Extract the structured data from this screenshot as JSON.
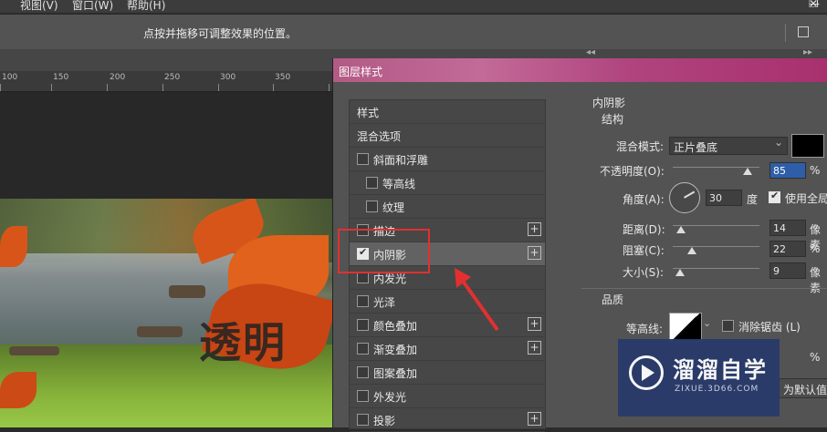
{
  "menu": {
    "view": "视图(V)",
    "window": "窗口(W)",
    "help": "帮助(H)"
  },
  "options_bar": {
    "hint": "点按并拖移可调整效果的位置。"
  },
  "ruler": {
    "ticks": [
      "100",
      "150",
      "200",
      "250",
      "300",
      "350"
    ]
  },
  "canvas": {
    "watermark_text": "透明"
  },
  "dialog": {
    "title": "图层样式",
    "styles_header": "样式",
    "blend_options": "混合选项",
    "items": [
      {
        "label": "斜面和浮雕",
        "checked": false,
        "plus": false,
        "indent": false
      },
      {
        "label": "等高线",
        "checked": false,
        "plus": false,
        "indent": true
      },
      {
        "label": "纹理",
        "checked": false,
        "plus": false,
        "indent": true
      },
      {
        "label": "描边",
        "checked": false,
        "plus": true,
        "indent": false
      },
      {
        "label": "内阴影",
        "checked": true,
        "plus": true,
        "indent": false,
        "selected": true
      },
      {
        "label": "内发光",
        "checked": false,
        "plus": false,
        "indent": false
      },
      {
        "label": "光泽",
        "checked": false,
        "plus": false,
        "indent": false
      },
      {
        "label": "颜色叠加",
        "checked": false,
        "plus": true,
        "indent": false
      },
      {
        "label": "渐变叠加",
        "checked": false,
        "plus": true,
        "indent": false
      },
      {
        "label": "图案叠加",
        "checked": false,
        "plus": false,
        "indent": false
      },
      {
        "label": "外发光",
        "checked": false,
        "plus": false,
        "indent": false
      },
      {
        "label": "投影",
        "checked": false,
        "plus": true,
        "indent": false
      }
    ],
    "inner_shadow": {
      "section_title": "内阴影",
      "structure_title": "结构",
      "blend_mode_label": "混合模式:",
      "blend_mode_value": "正片叠底",
      "shadow_color": "#000000",
      "opacity_label": "不透明度(O):",
      "opacity_value": "85",
      "opacity_unit": "%",
      "angle_label": "角度(A):",
      "angle_value": "30",
      "angle_unit": "度",
      "global_light_label": "使用全局",
      "distance_label": "距离(D):",
      "distance_value": "14",
      "distance_unit": "像素",
      "choke_label": "阻塞(C):",
      "choke_value": "22",
      "choke_unit": "%",
      "size_label": "大小(S):",
      "size_value": "9",
      "size_unit": "像素",
      "quality_title": "品质",
      "contour_label": "等高线:",
      "antialias_label": "消除锯齿 (L)",
      "noise_unit": "%",
      "default_button": "为默认值"
    }
  },
  "logo": {
    "name": "溜溜自学",
    "url": "ZIXUE.3D66.COM"
  }
}
